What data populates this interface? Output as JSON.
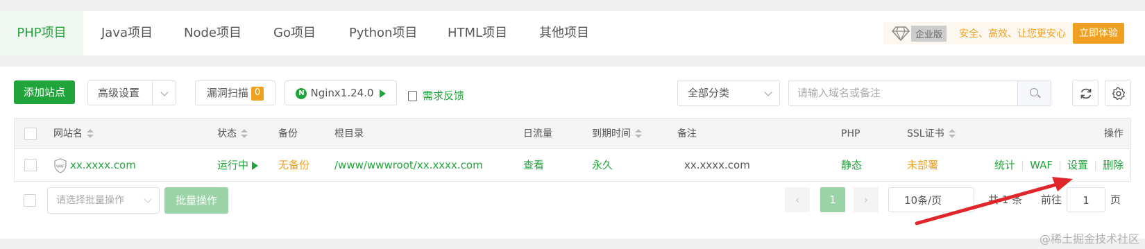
{
  "tabs": [
    {
      "label": "PHP项目",
      "active": true
    },
    {
      "label": "Java项目"
    },
    {
      "label": "Node项目"
    },
    {
      "label": "Go项目"
    },
    {
      "label": "Python项目"
    },
    {
      "label": "HTML项目"
    },
    {
      "label": "其他项目"
    }
  ],
  "promo": {
    "edition": "企业版",
    "slogan": "安全、高效、让您更安心",
    "try_button": "立即体验"
  },
  "toolbar": {
    "add_site": "添加站点",
    "advanced": "高级设置",
    "vuln_scan": "漏洞扫描",
    "vuln_count": "0",
    "nginx": "Nginx1.24.0",
    "feedback": "需求反馈",
    "category": "全部分类",
    "search_placeholder": "请输入域名或备注"
  },
  "table": {
    "headers": {
      "site_name": "网站名",
      "status": "状态",
      "backup": "备份",
      "root_dir": "根目录",
      "daily_traffic": "日流量",
      "expire": "到期时间",
      "remark": "备注",
      "php": "PHP",
      "ssl": "SSL证书",
      "actions": "操作"
    },
    "rows": [
      {
        "site_name": "xx.xxxx.com",
        "waf_badge": "WAF",
        "status": "运行中",
        "backup": "无备份",
        "root_dir": "/www/wwwroot/xx.xxxx.com",
        "daily_traffic": "查看",
        "expire": "永久",
        "remark": "xx.xxxx.com",
        "php": "静态",
        "ssl": "未部署",
        "actions": [
          "统计",
          "WAF",
          "设置",
          "删除"
        ]
      }
    ]
  },
  "footer": {
    "batch_placeholder": "请选择批量操作",
    "batch_button": "批量操作",
    "current_page": "1",
    "page_size": "10条/页",
    "total": "共 1 条",
    "goto_label": "前往",
    "goto_value": "1",
    "page_unit": "页"
  },
  "watermark": "@稀土掘金技术社区",
  "colors": {
    "accent": "#20a53a",
    "warning": "#f0a020",
    "annotation_arrow": "#e0262b"
  }
}
